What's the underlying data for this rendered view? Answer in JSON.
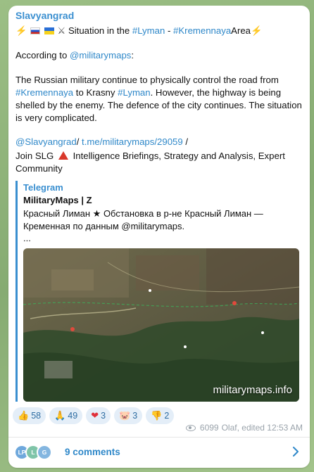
{
  "channel": {
    "name": "Slavyangrad"
  },
  "post": {
    "headline": {
      "lead_icons": "⚡",
      "swords": "⚔",
      "prefix": "Situation in the",
      "tag1": "#Lyman",
      "sep": "-",
      "tag2": "#Kremennaya",
      "suffix": "Area",
      "trail_icon": "⚡"
    },
    "according": {
      "prefix": "According to",
      "handle": "@militarymaps",
      "suffix": ":"
    },
    "body": {
      "p1": "The Russian military continue to physically control the road from",
      "tag1": "#Kremennaya",
      "p2": "to Krasny",
      "tag2": "#Lyman",
      "p3": ". However, the highway is being shelled by the enemy. The defence of the city continues. The situation is very complicated."
    },
    "links": {
      "handle": "@Slavyangrad",
      "sep1": "/",
      "url": "t.me/militarymaps/29059",
      "sep2": "/"
    },
    "join": {
      "prefix": "Join SLG",
      "suffix": "Intelligence Briefings, Strategy and Analysis, Expert Community"
    }
  },
  "quote": {
    "source": "Telegram",
    "author": "MilitaryMaps | Z",
    "text": "Красный Лиман ★ Обстановка в р-не Красный Лиман — Кременная по данным @militarymaps.",
    "more": "...",
    "watermark": "militarymaps.info"
  },
  "reactions": [
    {
      "emoji": "👍",
      "count": "58"
    },
    {
      "emoji": "🙏",
      "count": "49"
    },
    {
      "emoji": "❤",
      "count": "3"
    },
    {
      "emoji": "🐷",
      "count": "3"
    },
    {
      "emoji": "👎",
      "count": "2"
    }
  ],
  "meta": {
    "views": "6099",
    "author_edited": "Olaf, edited 12:53 AM"
  },
  "comments": {
    "label": "9 comments",
    "avatars": [
      {
        "initials": "LP",
        "color": "#6fa8dc"
      },
      {
        "initials": "L",
        "color": "#7fc4a8"
      },
      {
        "initials": "G",
        "color": "#84b6e0"
      }
    ]
  },
  "colors": {
    "accent": "#3a8fd0",
    "link": "#2f88c9"
  }
}
